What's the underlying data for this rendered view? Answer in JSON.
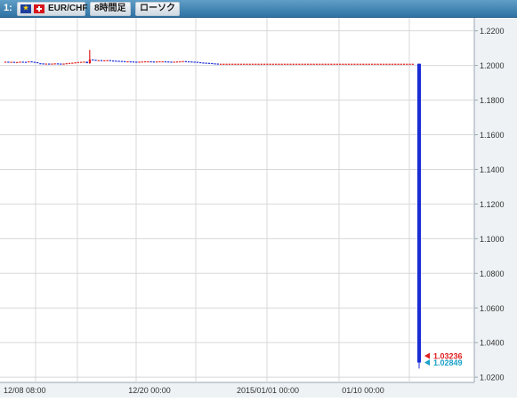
{
  "window": {
    "index": "1:",
    "pair": "EUR/CHF",
    "timeframe": "8時間足",
    "chart_type": "ローソク"
  },
  "colors": {
    "titlebar": "#3b7fb0",
    "bull": "#e02020",
    "bear": "#1a2bd6",
    "grid": "#d8d8d8",
    "bid_marker": "#e02020",
    "ask_marker": "#1aa0c8",
    "axis_bg": "#e8eef3"
  },
  "chart_data": {
    "type": "candlestick",
    "y_axis": {
      "ticks": [
        "1.2200",
        "1.2000",
        "1.1800",
        "1.1600",
        "1.1400",
        "1.1200",
        "1.1000",
        "1.0800",
        "1.0600",
        "1.0400",
        "1.0200"
      ],
      "range": [
        1.017,
        1.2265
      ]
    },
    "x_axis": {
      "labels": [
        "12/08 08:00",
        "12/20 00:00",
        "2015/01/01 00:00",
        "01/10 00:00"
      ]
    },
    "price_markers": [
      {
        "label": "1.03236",
        "value": 1.03236,
        "color": "bid"
      },
      {
        "label": "1.02849",
        "value": 1.02849,
        "color": "ask"
      }
    ],
    "candles_open": [
      1.2021,
      1.2022,
      1.202,
      1.2021,
      1.2019,
      1.202,
      1.2022,
      1.2021,
      1.2019,
      1.2024,
      1.2021,
      1.2019,
      1.2013,
      1.2012,
      1.201,
      1.2011,
      1.201,
      1.2011,
      1.2012,
      1.2011,
      1.201,
      1.2011,
      1.2013,
      1.2015,
      1.2016,
      1.2018,
      1.202,
      1.2021,
      1.2022,
      1.2013,
      1.2035,
      1.2033,
      1.203,
      1.2031,
      1.2029,
      1.203,
      1.2031,
      1.2029,
      1.2028,
      1.2027,
      1.2026,
      1.2025,
      1.2024,
      1.2024,
      1.2023,
      1.2022,
      1.2021,
      1.2022,
      1.2023,
      1.2024,
      1.2024,
      1.2023,
      1.2022,
      1.2023,
      1.2024,
      1.2024,
      1.2023,
      1.2022,
      1.2021,
      1.2022,
      1.2023,
      1.2024,
      1.2025,
      1.2024,
      1.2023,
      1.2022,
      1.2021,
      1.2019,
      1.2017,
      1.2016,
      1.2015,
      1.2014,
      1.2012,
      1.2011,
      1.201,
      1.201,
      1.201,
      1.201,
      1.201,
      1.201,
      1.201,
      1.201,
      1.201,
      1.201,
      1.201,
      1.201,
      1.201,
      1.201,
      1.201,
      1.201,
      1.201,
      1.201,
      1.201,
      1.201,
      1.201,
      1.201,
      1.201,
      1.201,
      1.201,
      1.201,
      1.201,
      1.201,
      1.201,
      1.201,
      1.201,
      1.201,
      1.201,
      1.201,
      1.201,
      1.201,
      1.201,
      1.201,
      1.201,
      1.201,
      1.201,
      1.201,
      1.201,
      1.201,
      1.201,
      1.201,
      1.201,
      1.201,
      1.201,
      1.201,
      1.201,
      1.201,
      1.201,
      1.201,
      1.201,
      1.201,
      1.201,
      1.201,
      1.201,
      1.201,
      1.201,
      1.201,
      1.201,
      1.201,
      1.201,
      1.201,
      1.201
    ],
    "candles_close": [
      1.2022,
      1.202,
      1.2021,
      1.2019,
      1.202,
      1.2022,
      1.2021,
      1.2019,
      1.2024,
      1.2021,
      1.2019,
      1.2013,
      1.2012,
      1.201,
      1.2011,
      1.201,
      1.2011,
      1.2012,
      1.2011,
      1.201,
      1.2011,
      1.2013,
      1.2015,
      1.2016,
      1.2018,
      1.202,
      1.2021,
      1.2022,
      1.2013,
      1.2035,
      1.2033,
      1.203,
      1.2031,
      1.2029,
      1.203,
      1.2031,
      1.2029,
      1.2028,
      1.2027,
      1.2026,
      1.2025,
      1.2024,
      1.2024,
      1.2023,
      1.2022,
      1.2021,
      1.2022,
      1.2023,
      1.2024,
      1.2024,
      1.2023,
      1.2022,
      1.2023,
      1.2024,
      1.2024,
      1.2023,
      1.2022,
      1.2021,
      1.2022,
      1.2023,
      1.2024,
      1.2025,
      1.2024,
      1.2023,
      1.2022,
      1.2021,
      1.2019,
      1.2017,
      1.2016,
      1.2015,
      1.2014,
      1.2012,
      1.2011,
      1.201,
      1.201,
      1.201,
      1.201,
      1.201,
      1.201,
      1.201,
      1.201,
      1.201,
      1.201,
      1.201,
      1.201,
      1.201,
      1.201,
      1.201,
      1.201,
      1.201,
      1.201,
      1.201,
      1.201,
      1.201,
      1.201,
      1.201,
      1.201,
      1.201,
      1.201,
      1.201,
      1.201,
      1.201,
      1.201,
      1.201,
      1.201,
      1.201,
      1.201,
      1.201,
      1.201,
      1.201,
      1.201,
      1.201,
      1.201,
      1.201,
      1.201,
      1.201,
      1.201,
      1.201,
      1.201,
      1.201,
      1.201,
      1.201,
      1.201,
      1.201,
      1.201,
      1.201,
      1.201,
      1.201,
      1.201,
      1.201,
      1.201,
      1.201,
      1.201,
      1.201,
      1.201,
      1.201,
      1.201,
      1.201,
      1.201,
      1.201,
      1.201
    ],
    "spike": {
      "index": 29,
      "high": 1.209,
      "low": 1.201
    },
    "crash_candle": {
      "open": 1.201,
      "close": 1.0285,
      "high": 1.201,
      "low": 1.025
    }
  }
}
